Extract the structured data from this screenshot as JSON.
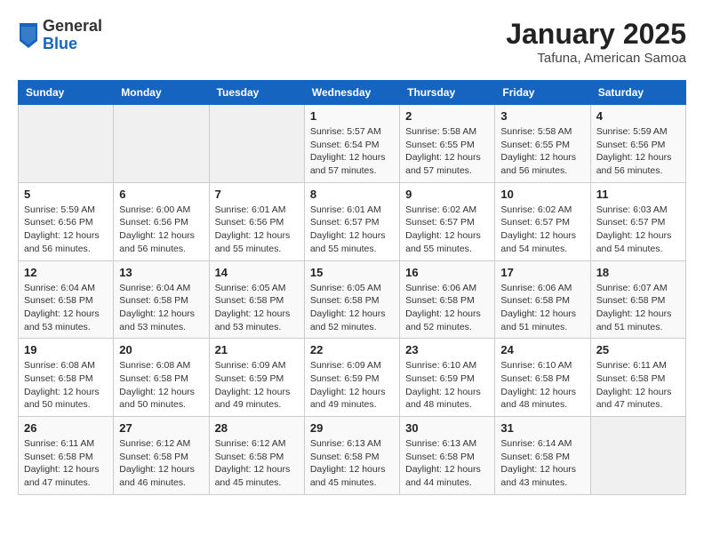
{
  "header": {
    "logo_general": "General",
    "logo_blue": "Blue",
    "month_title": "January 2025",
    "subtitle": "Tafuna, American Samoa"
  },
  "calendar": {
    "days_of_week": [
      "Sunday",
      "Monday",
      "Tuesday",
      "Wednesday",
      "Thursday",
      "Friday",
      "Saturday"
    ],
    "weeks": [
      [
        {
          "day": "",
          "info": ""
        },
        {
          "day": "",
          "info": ""
        },
        {
          "day": "",
          "info": ""
        },
        {
          "day": "1",
          "info": "Sunrise: 5:57 AM\nSunset: 6:54 PM\nDaylight: 12 hours\nand 57 minutes."
        },
        {
          "day": "2",
          "info": "Sunrise: 5:58 AM\nSunset: 6:55 PM\nDaylight: 12 hours\nand 57 minutes."
        },
        {
          "day": "3",
          "info": "Sunrise: 5:58 AM\nSunset: 6:55 PM\nDaylight: 12 hours\nand 56 minutes."
        },
        {
          "day": "4",
          "info": "Sunrise: 5:59 AM\nSunset: 6:56 PM\nDaylight: 12 hours\nand 56 minutes."
        }
      ],
      [
        {
          "day": "5",
          "info": "Sunrise: 5:59 AM\nSunset: 6:56 PM\nDaylight: 12 hours\nand 56 minutes."
        },
        {
          "day": "6",
          "info": "Sunrise: 6:00 AM\nSunset: 6:56 PM\nDaylight: 12 hours\nand 56 minutes."
        },
        {
          "day": "7",
          "info": "Sunrise: 6:01 AM\nSunset: 6:56 PM\nDaylight: 12 hours\nand 55 minutes."
        },
        {
          "day": "8",
          "info": "Sunrise: 6:01 AM\nSunset: 6:57 PM\nDaylight: 12 hours\nand 55 minutes."
        },
        {
          "day": "9",
          "info": "Sunrise: 6:02 AM\nSunset: 6:57 PM\nDaylight: 12 hours\nand 55 minutes."
        },
        {
          "day": "10",
          "info": "Sunrise: 6:02 AM\nSunset: 6:57 PM\nDaylight: 12 hours\nand 54 minutes."
        },
        {
          "day": "11",
          "info": "Sunrise: 6:03 AM\nSunset: 6:57 PM\nDaylight: 12 hours\nand 54 minutes."
        }
      ],
      [
        {
          "day": "12",
          "info": "Sunrise: 6:04 AM\nSunset: 6:58 PM\nDaylight: 12 hours\nand 53 minutes."
        },
        {
          "day": "13",
          "info": "Sunrise: 6:04 AM\nSunset: 6:58 PM\nDaylight: 12 hours\nand 53 minutes."
        },
        {
          "day": "14",
          "info": "Sunrise: 6:05 AM\nSunset: 6:58 PM\nDaylight: 12 hours\nand 53 minutes."
        },
        {
          "day": "15",
          "info": "Sunrise: 6:05 AM\nSunset: 6:58 PM\nDaylight: 12 hours\nand 52 minutes."
        },
        {
          "day": "16",
          "info": "Sunrise: 6:06 AM\nSunset: 6:58 PM\nDaylight: 12 hours\nand 52 minutes."
        },
        {
          "day": "17",
          "info": "Sunrise: 6:06 AM\nSunset: 6:58 PM\nDaylight: 12 hours\nand 51 minutes."
        },
        {
          "day": "18",
          "info": "Sunrise: 6:07 AM\nSunset: 6:58 PM\nDaylight: 12 hours\nand 51 minutes."
        }
      ],
      [
        {
          "day": "19",
          "info": "Sunrise: 6:08 AM\nSunset: 6:58 PM\nDaylight: 12 hours\nand 50 minutes."
        },
        {
          "day": "20",
          "info": "Sunrise: 6:08 AM\nSunset: 6:58 PM\nDaylight: 12 hours\nand 50 minutes."
        },
        {
          "day": "21",
          "info": "Sunrise: 6:09 AM\nSunset: 6:59 PM\nDaylight: 12 hours\nand 49 minutes."
        },
        {
          "day": "22",
          "info": "Sunrise: 6:09 AM\nSunset: 6:59 PM\nDaylight: 12 hours\nand 49 minutes."
        },
        {
          "day": "23",
          "info": "Sunrise: 6:10 AM\nSunset: 6:59 PM\nDaylight: 12 hours\nand 48 minutes."
        },
        {
          "day": "24",
          "info": "Sunrise: 6:10 AM\nSunset: 6:58 PM\nDaylight: 12 hours\nand 48 minutes."
        },
        {
          "day": "25",
          "info": "Sunrise: 6:11 AM\nSunset: 6:58 PM\nDaylight: 12 hours\nand 47 minutes."
        }
      ],
      [
        {
          "day": "26",
          "info": "Sunrise: 6:11 AM\nSunset: 6:58 PM\nDaylight: 12 hours\nand 47 minutes."
        },
        {
          "day": "27",
          "info": "Sunrise: 6:12 AM\nSunset: 6:58 PM\nDaylight: 12 hours\nand 46 minutes."
        },
        {
          "day": "28",
          "info": "Sunrise: 6:12 AM\nSunset: 6:58 PM\nDaylight: 12 hours\nand 45 minutes."
        },
        {
          "day": "29",
          "info": "Sunrise: 6:13 AM\nSunset: 6:58 PM\nDaylight: 12 hours\nand 45 minutes."
        },
        {
          "day": "30",
          "info": "Sunrise: 6:13 AM\nSunset: 6:58 PM\nDaylight: 12 hours\nand 44 minutes."
        },
        {
          "day": "31",
          "info": "Sunrise: 6:14 AM\nSunset: 6:58 PM\nDaylight: 12 hours\nand 43 minutes."
        },
        {
          "day": "",
          "info": ""
        }
      ]
    ]
  }
}
